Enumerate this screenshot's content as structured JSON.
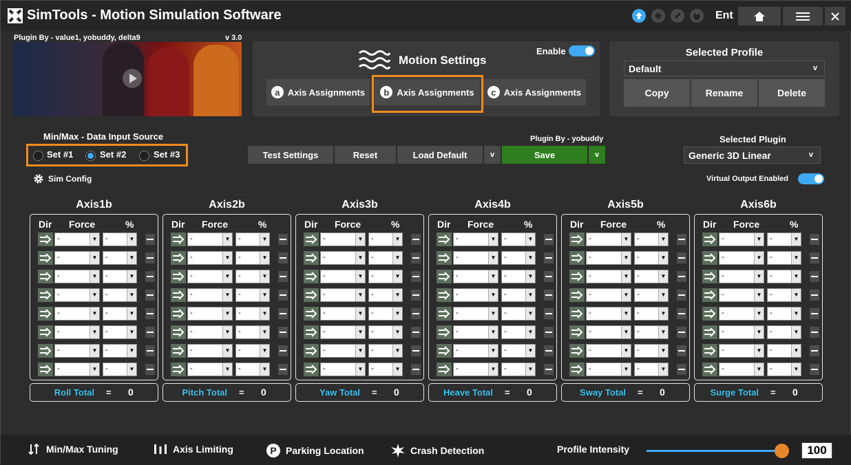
{
  "window": {
    "title": "SimTools - Motion Simulation Software",
    "user": "Ent"
  },
  "plugin_banner": {
    "credit": "Plugin By - value1, yobuddy, delta9",
    "version": "v 3.0"
  },
  "motion_settings": {
    "title": "Motion Settings",
    "enable_label": "Enable",
    "tabs": [
      {
        "letter": "a",
        "label": "Axis Assignments"
      },
      {
        "letter": "b",
        "label": "Axis Assignments",
        "selected": true
      },
      {
        "letter": "c",
        "label": "Axis Assignments"
      }
    ]
  },
  "profile": {
    "title": "Selected Profile",
    "selected": "Default",
    "chevron": "v",
    "copy_label": "Copy",
    "rename_label": "Rename",
    "delete_label": "Delete"
  },
  "data_source": {
    "title": "Min/Max - Data Input Source",
    "options": [
      "Set #1",
      "Set #2",
      "Set #3"
    ],
    "selected_index": 1
  },
  "toolbar": {
    "plugin_credit": "Plugin By - yobuddy",
    "test_label": "Test Settings",
    "reset_label": "Reset",
    "load_default_label": "Load Default",
    "load_default_chevron": "v",
    "save_label": "Save",
    "save_chevron": "v"
  },
  "plugin": {
    "title": "Selected Plugin",
    "selected": "Generic 3D Linear",
    "chevron": "v"
  },
  "sim_config_label": "Sim Config",
  "virtual_output_label": "Virtual Output Enabled",
  "axis_headers": {
    "dir": "Dir",
    "force": "Force",
    "percent": "%"
  },
  "axes": [
    {
      "name": "Axis1b",
      "total_label": "Roll Total",
      "total": "0",
      "rows": [
        "-",
        "-",
        "-",
        "-",
        "-",
        "-",
        "-",
        "-"
      ]
    },
    {
      "name": "Axis2b",
      "total_label": "Pitch Total",
      "total": "0",
      "rows": [
        "-",
        "-",
        "-",
        "-",
        "-",
        "-",
        "-",
        "-"
      ]
    },
    {
      "name": "Axis3b",
      "total_label": "Yaw Total",
      "total": "0",
      "rows": [
        "-",
        "-",
        "-",
        "-",
        "-",
        "-",
        "-",
        "-"
      ]
    },
    {
      "name": "Axis4b",
      "total_label": "Heave Total",
      "total": "0",
      "rows": [
        "-",
        "-",
        "-",
        "-",
        "-",
        "-",
        "-",
        "-"
      ]
    },
    {
      "name": "Axis5b",
      "total_label": "Sway Total",
      "total": "0",
      "rows": [
        "-",
        "-",
        "-",
        "-",
        "-",
        "-",
        "-",
        "-"
      ]
    },
    {
      "name": "Axis6b",
      "total_label": "Surge Total",
      "total": "0",
      "rows": [
        "-",
        "-",
        "-",
        "-",
        "-",
        "-",
        "-",
        "-"
      ]
    }
  ],
  "equals_sign": "=",
  "bottom_bar": {
    "minmax_label": "Min/Max Tuning",
    "axis_limiting_label": "Axis Limiting",
    "parking_label": "Parking Location",
    "crash_label": "Crash Detection",
    "intensity_label": "Profile Intensity",
    "intensity_value": "100",
    "intensity_fraction": 1.0
  },
  "colors": {
    "accent": "#3fa9f5",
    "highlight": "#f28c1c",
    "save": "#2e7d1e",
    "total_text": "#3fc6f2"
  }
}
